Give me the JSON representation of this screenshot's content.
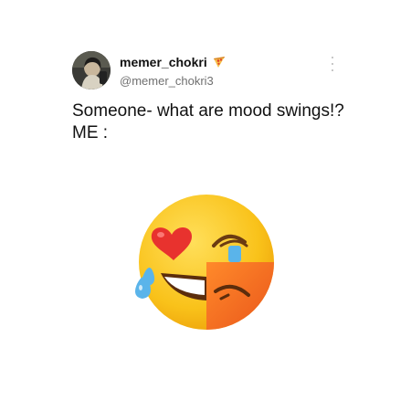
{
  "tweet": {
    "display_name": "memer_chokri",
    "handle": "@memer_chokri3",
    "text": "Someone- what are mood swings!? ME :",
    "badge_icon": "pizza-icon",
    "menu_icon": "more-vertical-icon",
    "media_icon": "mood-swing-emoji"
  },
  "colors": {
    "background": "#ffffff",
    "text": "#111111",
    "secondary": "#707070",
    "emoji_yellow": "#f9c21a",
    "emoji_orange": "#f26b1d",
    "heart_red": "#e8322e",
    "tear_blue": "#5ab4ea"
  }
}
